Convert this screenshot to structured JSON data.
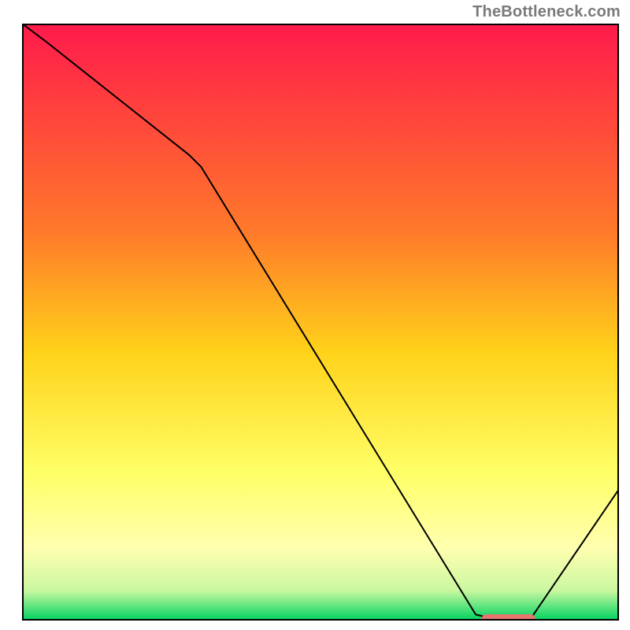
{
  "attribution": "TheBottleneck.com",
  "chart_data": {
    "type": "line",
    "title": "",
    "xlabel": "",
    "ylabel": "",
    "xlim": [
      0,
      100
    ],
    "ylim": [
      0,
      100
    ],
    "x": [
      0,
      4,
      28,
      30,
      76,
      80,
      85,
      100
    ],
    "values": [
      100,
      97,
      78,
      76,
      1,
      0,
      0,
      22
    ],
    "marker": {
      "x_start": 77,
      "x_end": 86,
      "y": 0
    },
    "gradient_stops": [
      {
        "pct": 0,
        "color": "#ff1a4b"
      },
      {
        "pct": 35,
        "color": "#ff7a2a"
      },
      {
        "pct": 55,
        "color": "#ffd21a"
      },
      {
        "pct": 75,
        "color": "#ffff66"
      },
      {
        "pct": 88,
        "color": "#ffffb0"
      },
      {
        "pct": 95,
        "color": "#c9f7a0"
      },
      {
        "pct": 98,
        "color": "#4fe27a"
      },
      {
        "pct": 100,
        "color": "#00d060"
      }
    ],
    "frame_color": "#000000",
    "line_color": "#000000",
    "marker_color": "#e5776f"
  }
}
